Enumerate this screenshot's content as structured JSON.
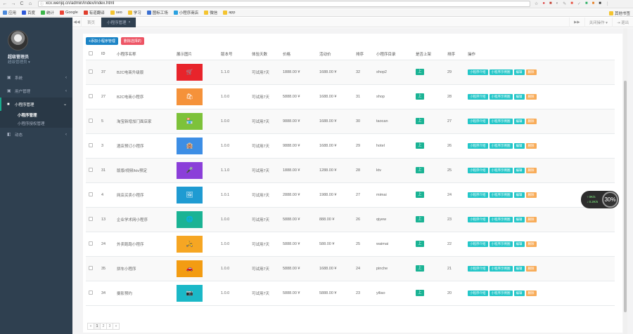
{
  "browser": {
    "url": "xcx.wenjq.cn/admin/index/index.html",
    "nav": [
      "←",
      "→",
      "C",
      "⌂"
    ]
  },
  "bookmarks": [
    {
      "label": "应用",
      "color": "#4a89dc"
    },
    {
      "label": "百度",
      "color": "#2e59d9"
    },
    {
      "label": "统计",
      "color": "#3bb54a"
    },
    {
      "label": "Google",
      "color": "#ea4335"
    },
    {
      "label": "有道翻译",
      "color": "#e03e2d"
    },
    {
      "label": "seo",
      "color": "#f4c430"
    },
    {
      "label": "学习",
      "color": "#f4c430"
    },
    {
      "label": "图标工场",
      "color": "#3b6fd1"
    },
    {
      "label": "小程序商店",
      "color": "#2aa1e0"
    },
    {
      "label": "微信",
      "color": "#f4c430"
    },
    {
      "label": "app",
      "color": "#f4c430"
    }
  ],
  "bookmarks_other": "其他书签",
  "sidebar": {
    "user_name": "超级管理员",
    "user_role": "超级管理员 ▾",
    "menu": [
      {
        "label": "系统",
        "icon": "▣",
        "active": false
      },
      {
        "label": "用户管理",
        "icon": "▣",
        "active": false
      },
      {
        "label": "小程序管理",
        "icon": "■",
        "active": true
      },
      {
        "label": "动态",
        "icon": "◧",
        "active": false
      }
    ],
    "submenu": [
      "小程序管理",
      "小程序授权管理"
    ]
  },
  "tabs": {
    "home": "首页",
    "current": "小程序管理",
    "close": "×",
    "prev": "◀◀",
    "next": "▶▶",
    "actions": "关闭操作 ▾",
    "logout": "⇥ 退出"
  },
  "toolbar": {
    "add_label": "+添加小程序管理",
    "del_label": "删除选择的"
  },
  "table": {
    "headers": [
      "",
      "ID",
      "小程序名称",
      "展示图片",
      "版本号",
      "体验天数",
      "价格",
      "活动价",
      "排序",
      "小程序目录",
      "是否上架",
      "排序",
      "操作"
    ],
    "rows": [
      {
        "id": "37",
        "name": "B2C电商升级版",
        "color": "#e8242b",
        "ver": "1.1.0",
        "days": "可试用7天",
        "price": "1888.00 ¥",
        "act": "1688.00 ¥",
        "sort": "32",
        "dir": "shop2",
        "rank": "29"
      },
      {
        "id": "27",
        "name": "B2C电商小程序",
        "color": "#f5923a",
        "ver": "1.0.0",
        "days": "可试用7天",
        "price": "5888.00 ¥",
        "act": "1688.00 ¥",
        "sort": "31",
        "dir": "shop",
        "rank": "28"
      },
      {
        "id": "5",
        "name": "淘宝新增加门面店家",
        "color": "#7dc23a",
        "ver": "1.0.0",
        "days": "可试用7天",
        "price": "9888.00 ¥",
        "act": "1688.00 ¥",
        "sort": "30",
        "dir": "taocan",
        "rank": "27"
      },
      {
        "id": "3",
        "name": "酒店预订小程序",
        "color": "#3d8ee5",
        "ver": "1.0.0",
        "days": "可试用7天",
        "price": "9888.00 ¥",
        "act": "1688.00 ¥",
        "sort": "29",
        "dir": "hotel",
        "rank": "26"
      },
      {
        "id": "31",
        "name": "版版/视频/ktv预定",
        "color": "#8b3fd9",
        "ver": "1.1.0",
        "days": "可试用7天",
        "price": "1888.00 ¥",
        "act": "1288.00 ¥",
        "sort": "28",
        "dir": "ktv",
        "rank": "25"
      },
      {
        "id": "4",
        "name": "网店买卖小程序",
        "color": "#1f9bd2",
        "ver": "1.0.1",
        "days": "可试用7天",
        "price": "2888.00 ¥",
        "act": "1988.00 ¥",
        "sort": "27",
        "dir": "mimai",
        "rank": "24"
      },
      {
        "id": "13",
        "name": "企业学术网小程序",
        "color": "#1ab394",
        "ver": "1.0.0",
        "days": "可试用7天",
        "price": "5888.00 ¥",
        "act": "888.00 ¥",
        "sort": "26",
        "dir": "qiyew",
        "rank": "23"
      },
      {
        "id": "24",
        "name": "外卖跑跑小程序",
        "color": "#f6a623",
        "ver": "1.0.0",
        "days": "可试用7天",
        "price": "5888.00 ¥",
        "act": "588.00 ¥",
        "sort": "25",
        "dir": "waimai",
        "rank": "22"
      },
      {
        "id": "35",
        "name": "拼车小程序",
        "color": "#f39c12",
        "ver": "1.0.0",
        "days": "可试用7天",
        "price": "5888.00 ¥",
        "act": "1688.00 ¥",
        "sort": "24",
        "dir": "pinche",
        "rank": "21"
      },
      {
        "id": "34",
        "name": "摄影预约",
        "color": "#1bb8c7",
        "ver": "1.0.0",
        "days": "可试用7天",
        "price": "5888.00 ¥",
        "act": "5888.00 ¥",
        "sort": "23",
        "dir": "yiliao",
        "rank": "20"
      }
    ],
    "on_shelf": "上",
    "ops": [
      "小程序介绍",
      "小程序示例图",
      "编辑",
      "删除"
    ]
  },
  "pager": [
    "«",
    "1",
    "2",
    "3",
    "»"
  ],
  "speed": {
    "up": "↑ 0K/s",
    "down": "↓ 0.2K/s",
    "pct": "30%"
  }
}
